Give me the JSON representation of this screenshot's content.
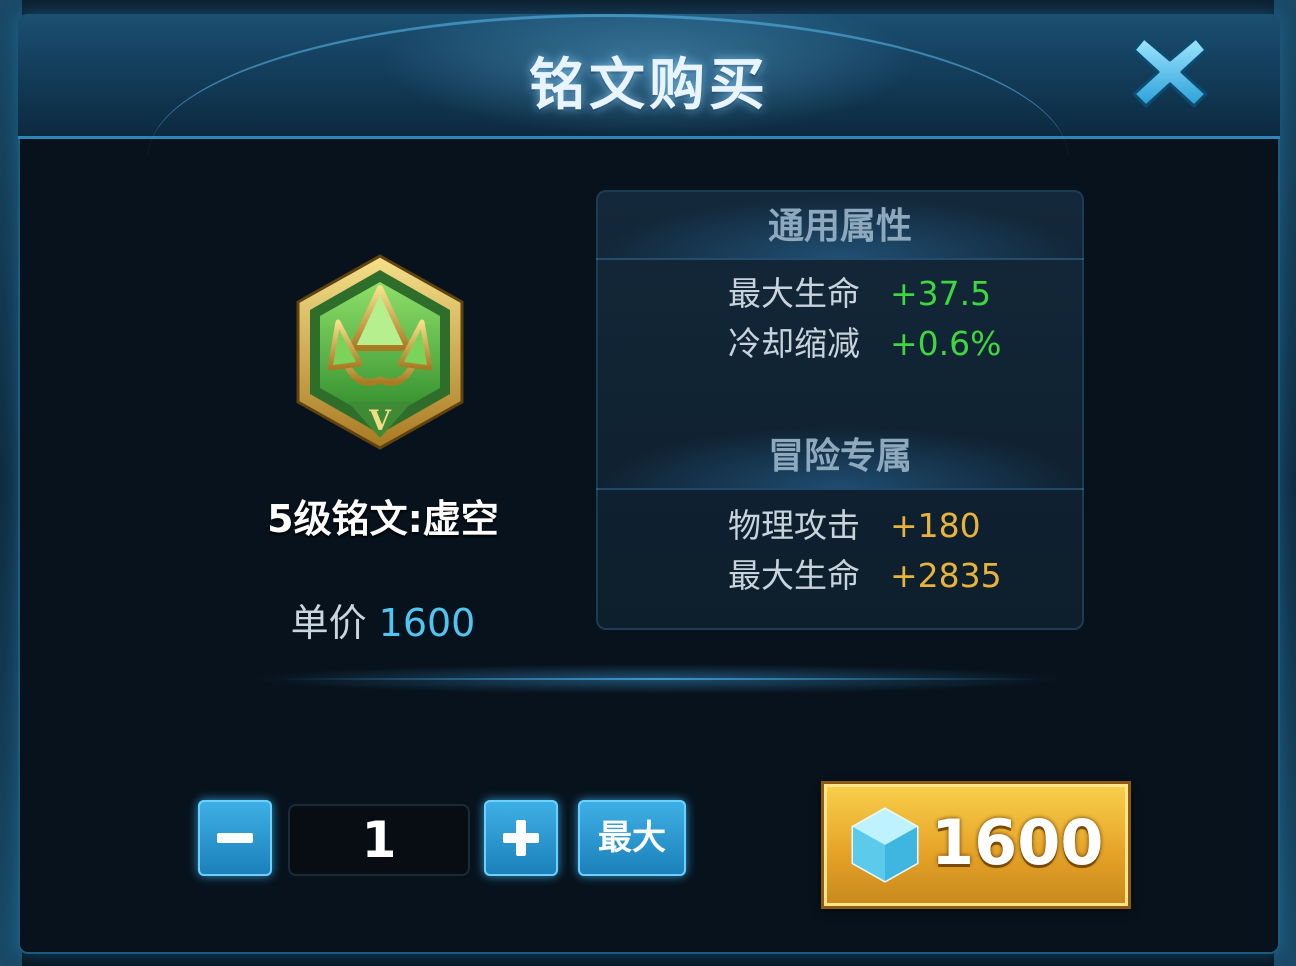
{
  "dialog": {
    "title": "铭文购买",
    "close_icon": "close-x-icon"
  },
  "rune": {
    "icon": "rune-tier-5-green-hexagon-icon",
    "tier_mark": "V",
    "name": "5级铭文:虚空",
    "price_label": "单价",
    "price_value": "1600"
  },
  "attributes": {
    "general": {
      "heading": "通用属性",
      "rows": [
        {
          "name": "最大生命",
          "value": "+37.5"
        },
        {
          "name": "冷却缩减",
          "value": "+0.6%"
        }
      ]
    },
    "adventure": {
      "heading": "冒险专属",
      "rows": [
        {
          "name": "物理攻击",
          "value": "+180"
        },
        {
          "name": "最大生命",
          "value": "+2835"
        }
      ]
    }
  },
  "quantity": {
    "minus_icon": "minus-icon",
    "value": "1",
    "plus_icon": "plus-icon",
    "max_label": "最大"
  },
  "buy": {
    "currency_icon": "diamond-gem-icon",
    "total": "1600"
  },
  "colors": {
    "general_value": "#3fd63f",
    "adventure_value": "#e8b33c",
    "price_value": "#4fc6f2",
    "buy_button": "#e7a428",
    "accent_blue": "#3fb1e6"
  }
}
